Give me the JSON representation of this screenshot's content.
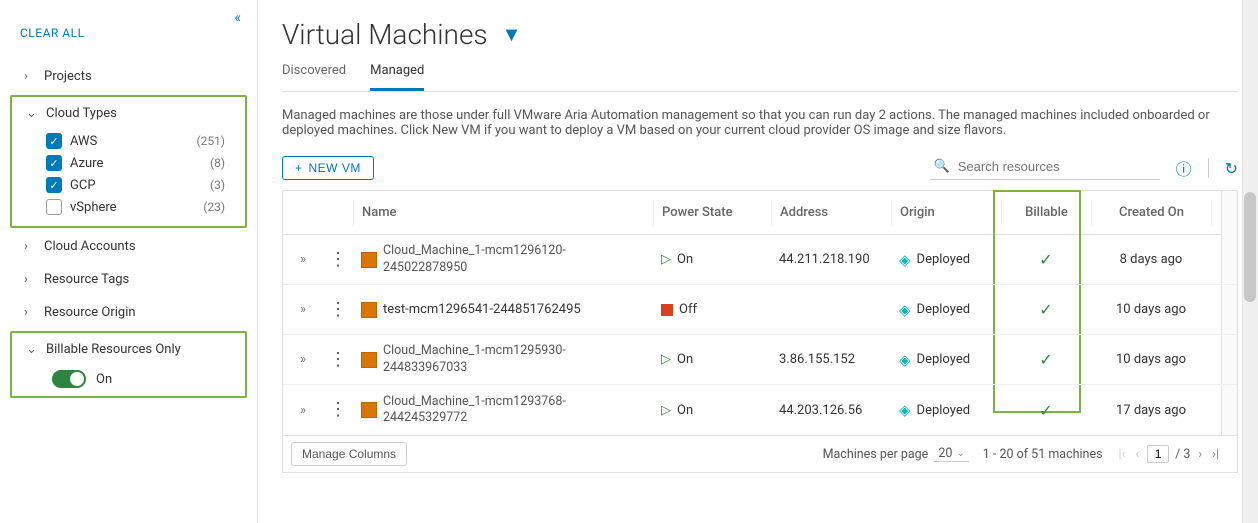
{
  "sidebar": {
    "clear_all": "CLEAR ALL",
    "projects": {
      "label": "Projects",
      "expanded": false
    },
    "cloud_types": {
      "label": "Cloud Types",
      "expanded": true,
      "options": [
        {
          "label": "AWS",
          "count": "(251)",
          "checked": true
        },
        {
          "label": "Azure",
          "count": "(8)",
          "checked": true
        },
        {
          "label": "GCP",
          "count": "(3)",
          "checked": true
        },
        {
          "label": "vSphere",
          "count": "(23)",
          "checked": false
        }
      ]
    },
    "cloud_accounts": {
      "label": "Cloud Accounts",
      "expanded": false
    },
    "resource_tags": {
      "label": "Resource Tags",
      "expanded": false
    },
    "resource_origin": {
      "label": "Resource Origin",
      "expanded": false
    },
    "billable": {
      "label": "Billable Resources Only",
      "expanded": true,
      "toggle_label": "On",
      "toggle_on": true
    }
  },
  "main": {
    "title": "Virtual Machines",
    "tabs": {
      "discovered": "Discovered",
      "managed": "Managed"
    },
    "description": "Managed machines are those under full VMware Aria Automation management so that you can run day 2 actions. The managed machines included onboarded or deployed machines. Click New VM if you want to deploy a VM based on your current cloud provider OS image and size flavors.",
    "new_vm": "NEW VM",
    "search_placeholder": "Search resources",
    "columns": {
      "name": "Name",
      "power": "Power State",
      "address": "Address",
      "origin": "Origin",
      "billable": "Billable",
      "created": "Created On"
    },
    "rows": [
      {
        "name": "Cloud_Machine_1-mcm1296120-245022878950",
        "power": "On",
        "address": "44.211.218.190",
        "origin": "Deployed",
        "billable": true,
        "created": "8 days ago"
      },
      {
        "name": "test-mcm1296541-244851762495",
        "power": "Off",
        "address": "",
        "origin": "Deployed",
        "billable": true,
        "created": "10 days ago"
      },
      {
        "name": "Cloud_Machine_1-mcm1295930-244833967033",
        "power": "On",
        "address": "3.86.155.152",
        "origin": "Deployed",
        "billable": true,
        "created": "10 days ago"
      },
      {
        "name": "Cloud_Machine_1-mcm1293768-244245329772",
        "power": "On",
        "address": "44.203.126.56",
        "origin": "Deployed",
        "billable": true,
        "created": "17 days ago"
      }
    ],
    "footer": {
      "manage_columns": "Manage Columns",
      "per_page_label": "Machines per page",
      "per_page_value": "20",
      "range": "1 - 20 of 51 machines",
      "page_current": "1",
      "page_total": "/ 3"
    }
  }
}
